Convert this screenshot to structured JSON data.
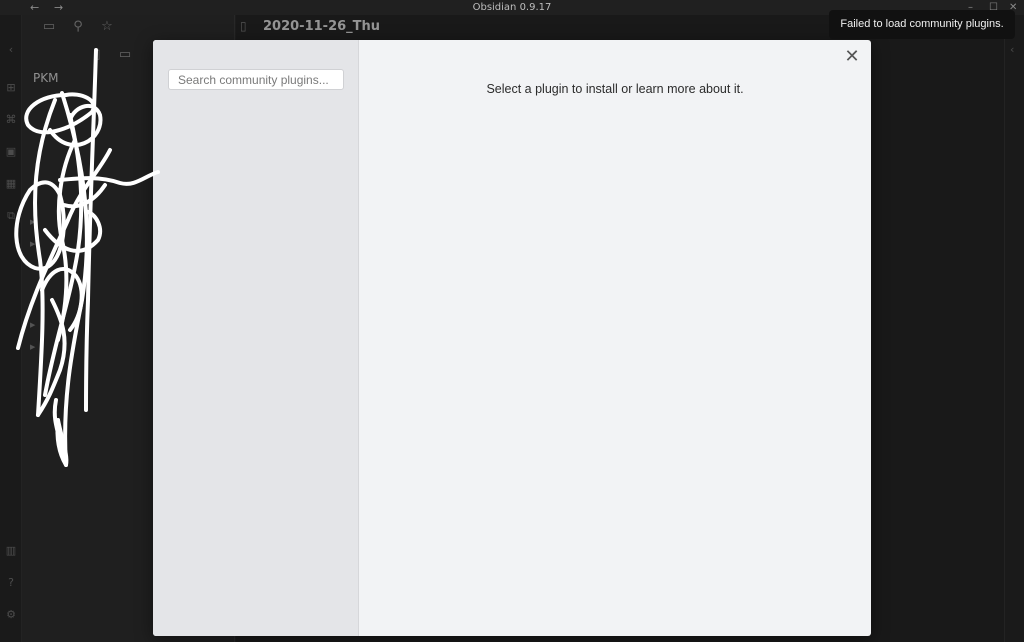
{
  "window": {
    "title": "Obsidian 0.9.17",
    "back_icon": "arrow-left-icon",
    "forward_icon": "arrow-right-icon",
    "minimize": "–",
    "maximize": "☐",
    "close": "✕"
  },
  "ribbon": {
    "icons": [
      "chevron-left-icon",
      "graph-icon",
      "command-icon",
      "dice-icon",
      "calendar-icon",
      "template-icon",
      "vault-icon",
      "help-icon",
      "settings-icon"
    ]
  },
  "explorer": {
    "vault_name": "PKM",
    "toolbar_icons": [
      "folder-icon",
      "search-icon",
      "star-icon",
      "new-note-icon",
      "new-folder-icon"
    ]
  },
  "editor": {
    "tab_title": "2020-11-26_Thu"
  },
  "modal": {
    "search": {
      "placeholder": "Search community plugins...",
      "value": ""
    },
    "empty_message": "Select a plugin to install or learn more about it.",
    "close_label": "✕"
  },
  "notice": {
    "text": "Failed to load community plugins."
  },
  "colors": {
    "app_background": "#2a2a2a",
    "modal_background": "#f2f3f5",
    "modal_sidebar": "#e4e5e8",
    "notice_background": "#111111"
  }
}
